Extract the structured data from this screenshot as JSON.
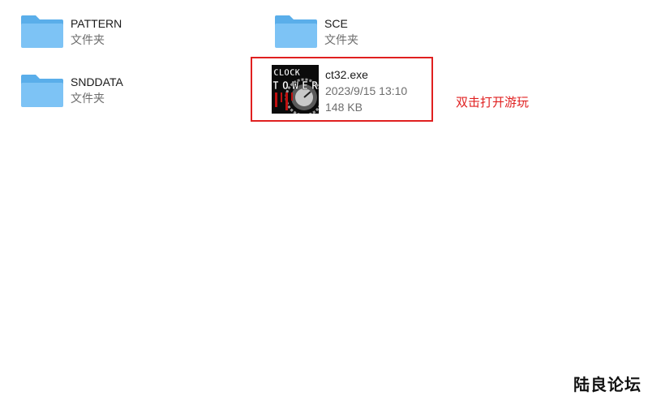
{
  "files": [
    {
      "name": "PATTERN",
      "type": "文件夹",
      "icon": "folder-icon"
    },
    {
      "name": "SCE",
      "type": "文件夹",
      "icon": "folder-icon"
    },
    {
      "name": "SNDDATA",
      "type": "文件夹",
      "icon": "folder-icon"
    },
    {
      "name": "ct32.exe",
      "date": "2023/9/15 13:10",
      "size": "148 KB",
      "icon": "clock-tower-app-icon"
    }
  ],
  "exe_icon_text": [
    "CLOCK",
    "TOWER"
  ],
  "annotation": "双击打开游玩",
  "watermark": "陆良论坛",
  "colors": {
    "highlight": "#e02020",
    "folder_front": "#7dc3f5",
    "folder_back": "#5aaeea"
  }
}
